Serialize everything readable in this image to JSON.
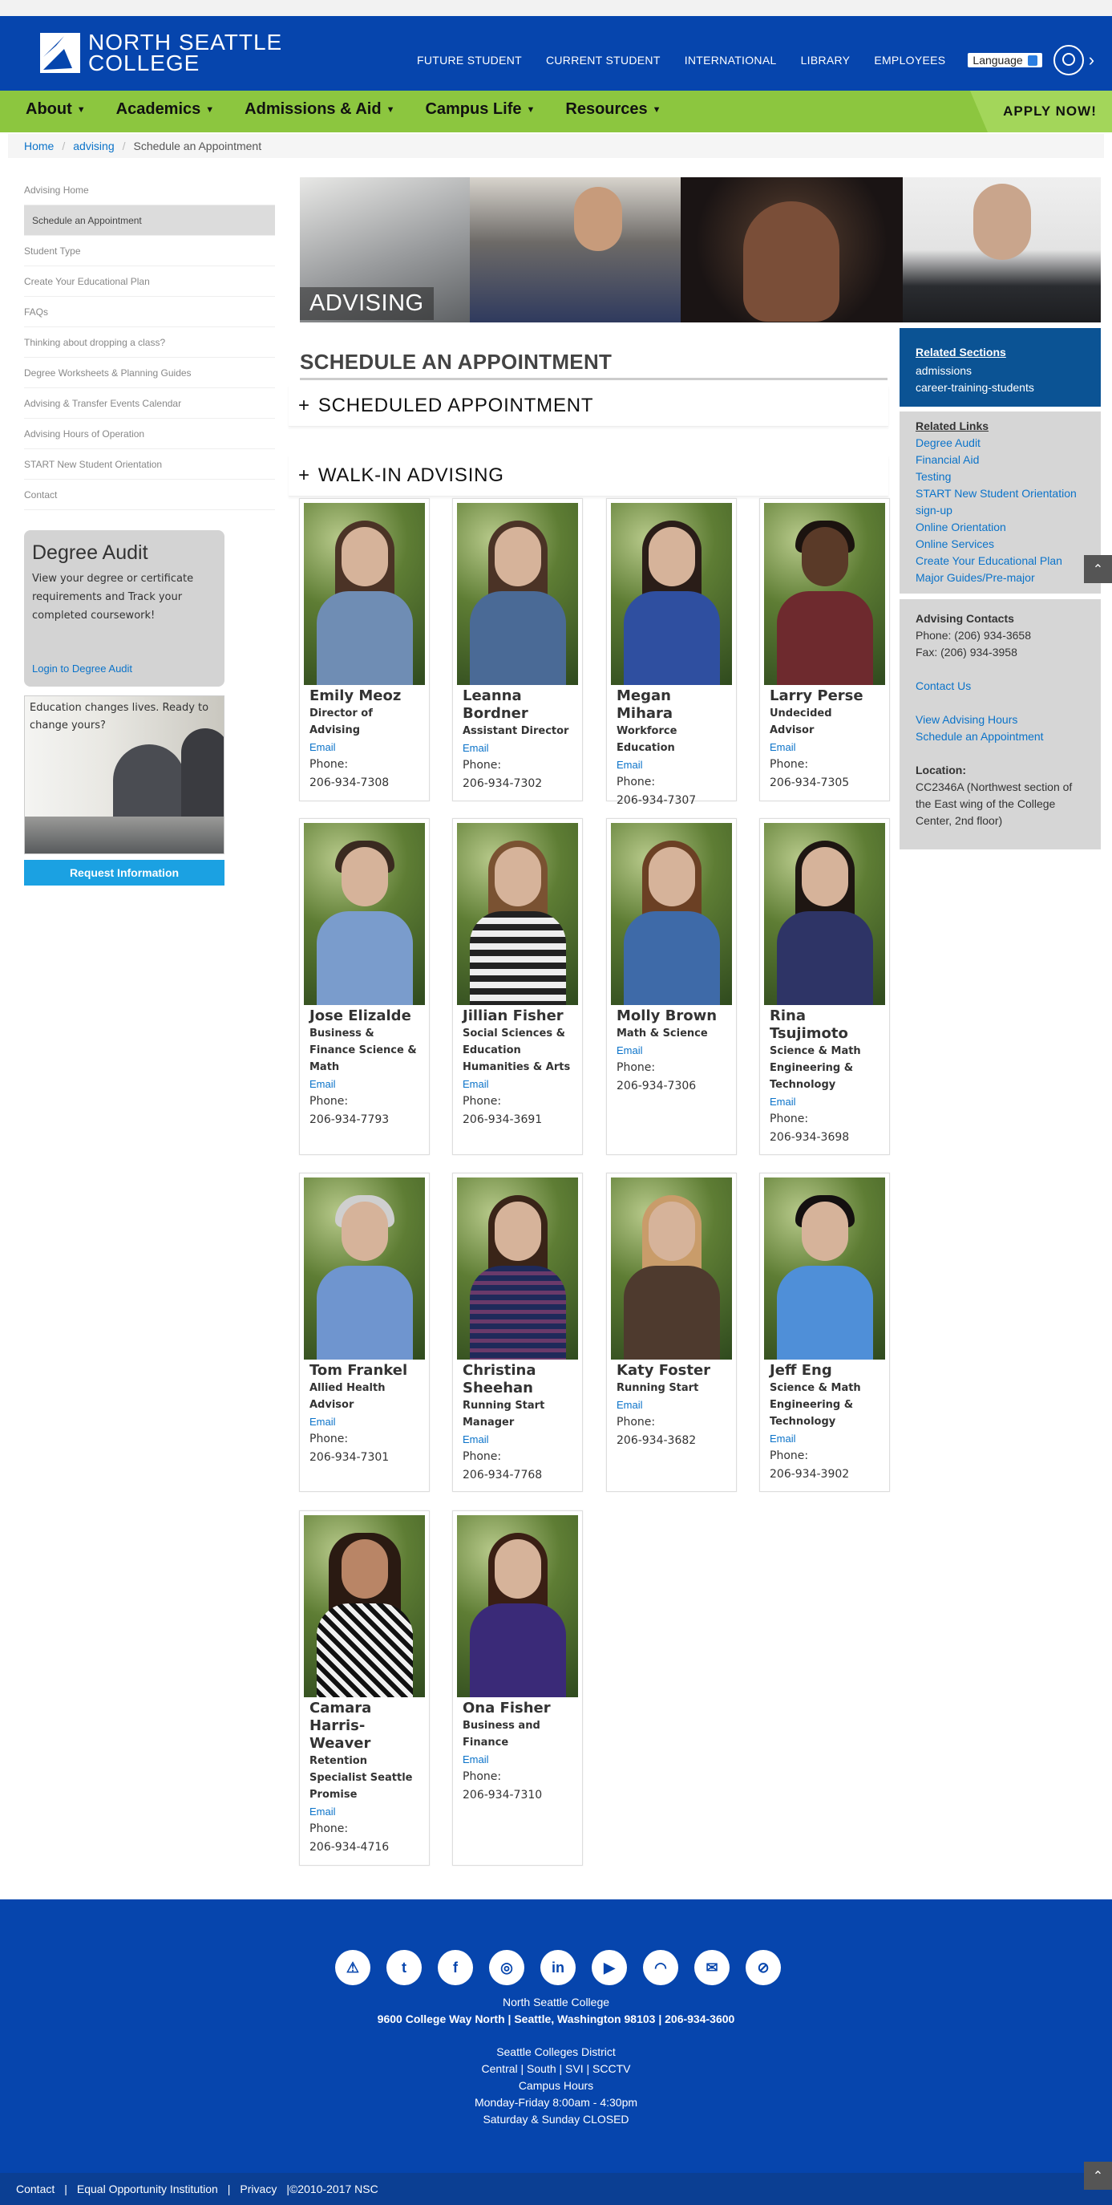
{
  "header": {
    "logo_line1": "NORTH SEATTLE",
    "logo_line2": "COLLEGE",
    "top_nav": [
      "FUTURE STUDENT",
      "CURRENT STUDENT",
      "INTERNATIONAL",
      "LIBRARY",
      "EMPLOYEES"
    ],
    "language": "Language"
  },
  "main_nav": {
    "items": [
      "About",
      "Academics",
      "Admissions & Aid",
      "Campus Life",
      "Resources"
    ],
    "apply": "APPLY NOW!"
  },
  "breadcrumb": [
    "Home",
    "advising",
    "Schedule an Appointment"
  ],
  "side_nav": [
    "Advising Home",
    "Schedule an Appointment",
    "Student Type",
    "Create Your Educational Plan",
    "FAQs",
    "Thinking about dropping a class?",
    "Degree Worksheets & Planning Guides",
    "Advising & Transfer Events Calendar",
    "Advising Hours of Operation",
    "START New Student Orientation",
    "Contact"
  ],
  "degree_audit": {
    "title": "Degree Audit",
    "text": "View your degree or certificate requirements and Track your completed coursework!",
    "link": "Login to Degree Audit"
  },
  "promo": {
    "text": "Education changes lives. Ready to change yours?"
  },
  "request_button": "Request Information",
  "hero_label": "ADVISING",
  "page_title": "SCHEDULE AN APPOINTMENT",
  "accordions": [
    "SCHEDULED APPOINTMENT",
    "WALK-IN ADVISING"
  ],
  "staff": [
    {
      "name": "Emily Meoz",
      "role": "Director of Advising",
      "email": "Email",
      "phone_label": "Phone:",
      "phone": "206-934-7308"
    },
    {
      "name": "Leanna Bordner",
      "role": "Assistant Director",
      "email": "Email",
      "phone_label": "Phone:",
      "phone": "206-934-7302"
    },
    {
      "name": "Megan Mihara",
      "role": "Workforce Education",
      "email": "Email",
      "phone_label": "Phone:",
      "phone": "206-934-7307"
    },
    {
      "name": "Larry Perse",
      "role": "Undecided Advisor",
      "email": "Email",
      "phone_label": "Phone:",
      "phone": "206-934-7305"
    },
    {
      "name": "Jose Elizalde",
      "role": "Business & Finance Science & Math",
      "email": "Email",
      "phone_label": "Phone:",
      "phone": "206-934-7793"
    },
    {
      "name": "Jillian Fisher",
      "role": "Social Sciences & Education Humanities & Arts",
      "email": "Email",
      "phone_label": "Phone:",
      "phone": "206-934-3691"
    },
    {
      "name": "Molly Brown",
      "role": "Math & Science",
      "email": "Email",
      "phone_label": "Phone:",
      "phone": "206-934-7306"
    },
    {
      "name": "Rina Tsujimoto",
      "role": "Science & Math Engineering & Technology",
      "email": "Email",
      "phone_label": "Phone:",
      "phone": "206-934-3698"
    },
    {
      "name": "Tom Frankel",
      "role": "Allied Health Advisor",
      "email": "Email",
      "phone_label": "Phone:",
      "phone": "206-934-7301"
    },
    {
      "name": "Christina Sheehan",
      "role": "Running Start Manager",
      "email": "Email",
      "phone_label": "Phone:",
      "phone": "206-934-7768"
    },
    {
      "name": "Katy Foster",
      "role": "Running Start",
      "email": "Email",
      "phone_label": "Phone:",
      "phone": "206-934-3682"
    },
    {
      "name": "Jeff Eng",
      "role": "Science & Math Engineering & Technology",
      "email": "Email",
      "phone_label": "Phone:",
      "phone": "206-934-3902"
    },
    {
      "name": "Camara Harris-Weaver",
      "role": "Retention Specialist Seattle Promise",
      "email": "Email",
      "phone_label": "Phone:",
      "phone": "206-934-4716"
    },
    {
      "name": "Ona Fisher",
      "role": "Business and Finance",
      "email": "Email",
      "phone_label": "Phone:",
      "phone": "206-934-7310"
    }
  ],
  "related_sections": {
    "heading": "Related Sections",
    "items": [
      "admissions",
      "career-training-students"
    ]
  },
  "related_links": {
    "heading": "Related Links",
    "items": [
      "Degree Audit",
      "Financial Aid",
      "Testing",
      "START New Student Orientation sign-up",
      "Online Orientation",
      "Online Services",
      "Create Your Educational Plan",
      "Major Guides/Pre-major"
    ]
  },
  "contacts": {
    "heading": "Advising Contacts",
    "phone": "Phone: (206) 934-3658",
    "fax": "Fax: (206) 934-3958",
    "contact_link": "Contact Us",
    "hours_link": "View Advising Hours",
    "schedule_link": "Schedule an Appointment",
    "location_label": "Location:",
    "location": "CC2346A (Northwest section of the East wing of the College Center, 2nd floor)"
  },
  "footer": {
    "social_icons": [
      "alert-icon",
      "twitter-icon",
      "facebook-icon",
      "instagram-icon",
      "linkedin-icon",
      "youtube-icon",
      "rss-icon",
      "email-icon",
      "no-smoking-icon"
    ],
    "college": "North Seattle College",
    "address": "9600 College Way North | Seattle, Washington 98103 | 206-934-3600",
    "district": "Seattle Colleges District",
    "district_links": "Central | South | SVI | SCCTV",
    "hours_title": "Campus Hours",
    "hours_weekday": "Monday-Friday 8:00am - 4:30pm",
    "hours_weekend": "Saturday & Sunday CLOSED",
    "bottom_links": [
      "Contact",
      "|",
      "Equal Opportunity Institution",
      "|",
      "Privacy",
      "|©2010-2017 NSC"
    ]
  },
  "colors": {
    "header_blue": "#0645ad",
    "nav_green": "#8cc63f",
    "link_blue": "#0b73c9",
    "button_blue": "#1ba1e2"
  }
}
